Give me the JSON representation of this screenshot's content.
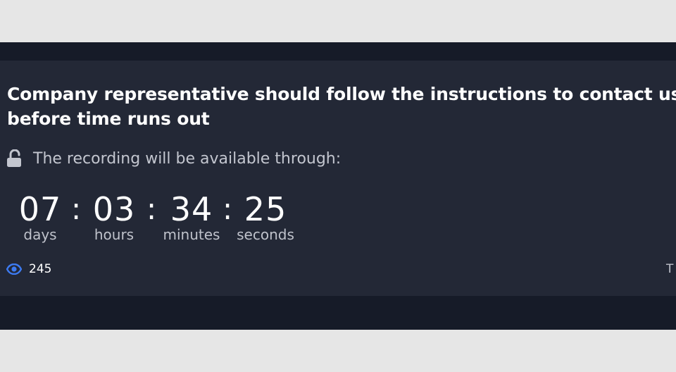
{
  "card": {
    "headline_line1": "Company representative should follow the instructions to contact us",
    "headline_line2": "before time runs out",
    "availability_text": "The recording will be available through:",
    "lock_icon": "unlocked-padlock-icon",
    "countdown": {
      "days": {
        "value": "07",
        "label": "days"
      },
      "hours": {
        "value": "03",
        "label": "hours"
      },
      "minutes": {
        "value": "34",
        "label": "minutes"
      },
      "seconds": {
        "value": "25",
        "label": "seconds"
      },
      "separator": ":"
    },
    "views": {
      "icon": "eye-icon",
      "count": "245"
    },
    "edge_text": "T"
  },
  "colors": {
    "page_background": "#e6e6e6",
    "band_background": "#161b28",
    "card_background": "#232836",
    "accent_eye": "#3d7bf2",
    "text_primary": "#ffffff",
    "text_secondary": "#c3c6cf"
  }
}
